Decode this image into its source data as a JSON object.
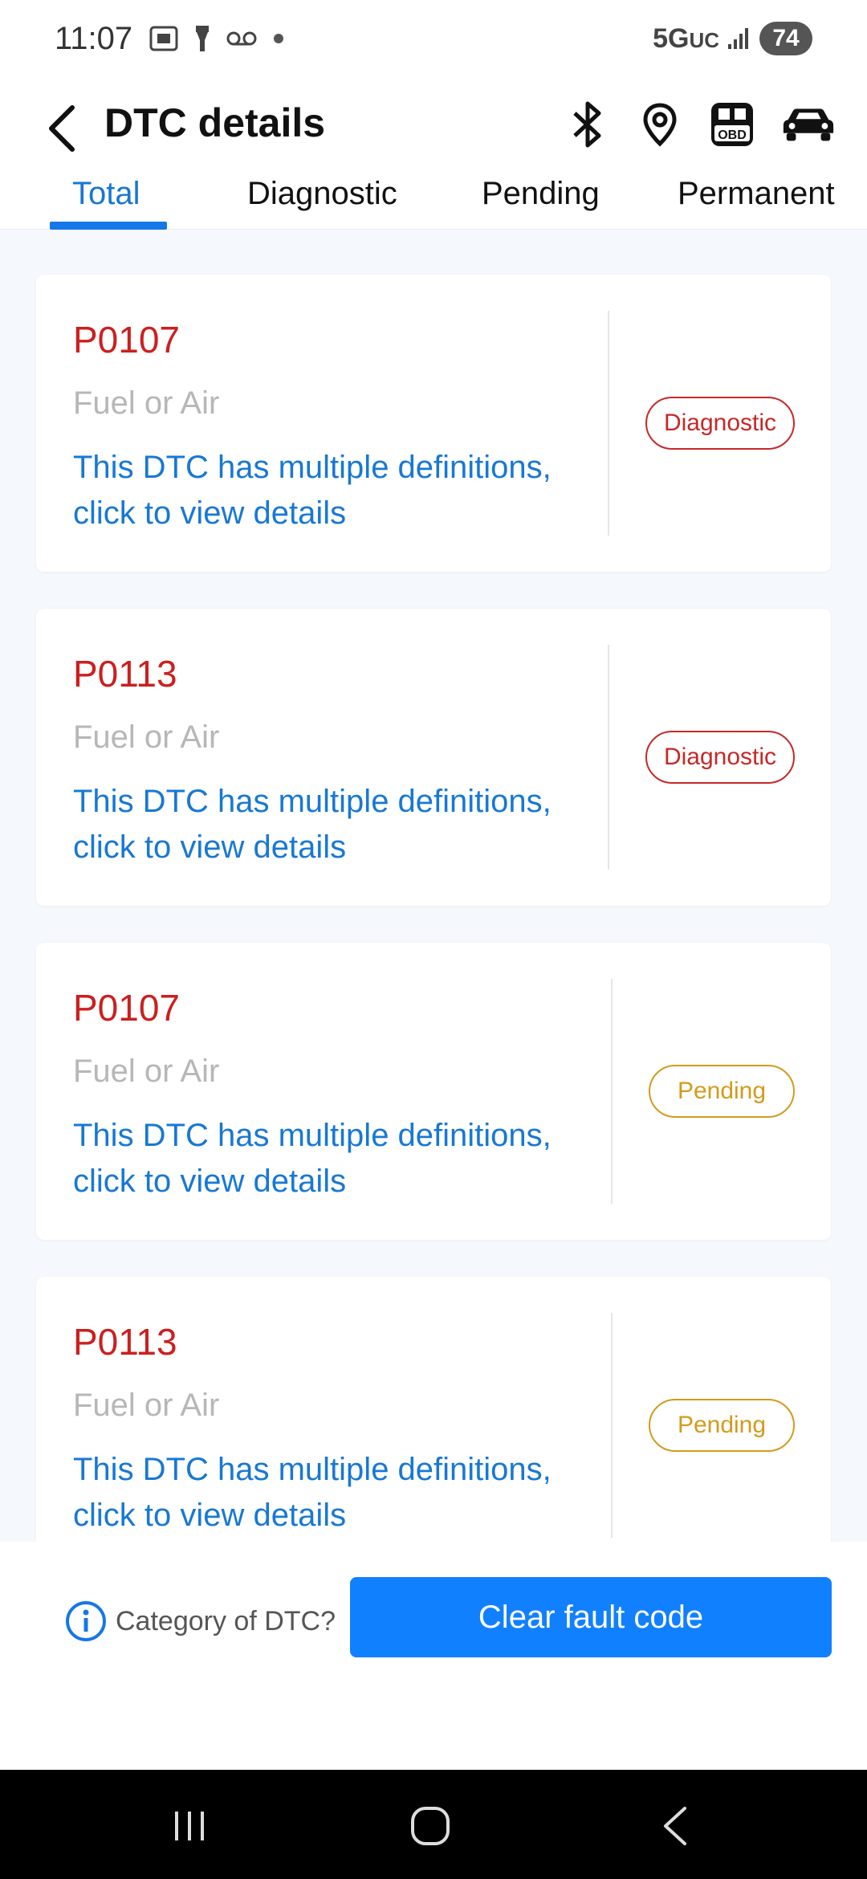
{
  "status_bar": {
    "time": "11:07",
    "network": "5G",
    "network_suffix": "UC",
    "battery": "74"
  },
  "header": {
    "title": "DTC details",
    "icons": [
      "back-icon",
      "bluetooth-icon",
      "location-icon",
      "obd-icon",
      "car-icon"
    ],
    "obd_label": "OBD"
  },
  "tabs": [
    {
      "label": "Total",
      "active": true
    },
    {
      "label": "Diagnostic",
      "active": false
    },
    {
      "label": "Pending",
      "active": false
    },
    {
      "label": "Permanent",
      "active": false
    }
  ],
  "dtc_list": [
    {
      "code": "P0107",
      "type": "Fuel or Air",
      "description": "This DTC has multiple definitions, click to view details",
      "status": "Diagnostic"
    },
    {
      "code": "P0113",
      "type": "Fuel or Air",
      "description": "This DTC has multiple definitions, click to view details",
      "status": "Diagnostic"
    },
    {
      "code": "P0107",
      "type": "Fuel or Air",
      "description": "This DTC has multiple definitions, click to view details",
      "status": "Pending"
    },
    {
      "code": "P0113",
      "type": "Fuel or Air",
      "description": "This DTC has multiple definitions, click to view details",
      "status": "Pending"
    }
  ],
  "bottom": {
    "info_label": "Category of DTC?",
    "clear_button": "Clear fault code"
  },
  "colors": {
    "accent": "#1180ff",
    "code_red": "#cc1f1f",
    "diagnostic": "#c62828",
    "pending": "#d39b1c",
    "link_blue": "#1878d4"
  }
}
